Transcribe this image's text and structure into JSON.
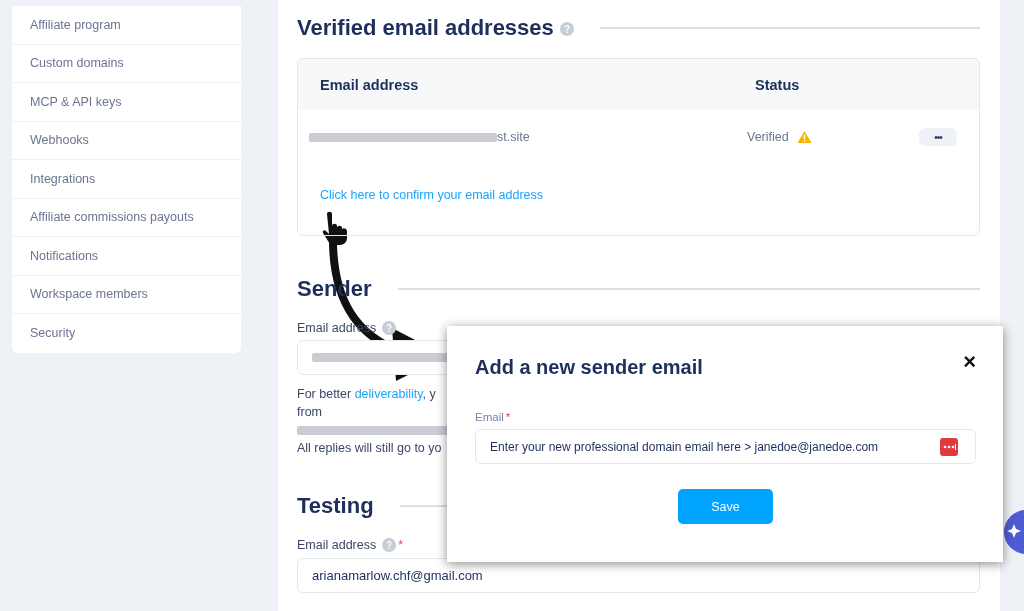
{
  "sidebar": {
    "items": [
      {
        "label": "Affiliate program"
      },
      {
        "label": "Custom domains"
      },
      {
        "label": "MCP & API keys"
      },
      {
        "label": "Webhooks"
      },
      {
        "label": "Integrations"
      },
      {
        "label": "Affiliate commissions payouts"
      },
      {
        "label": "Notifications"
      },
      {
        "label": "Workspace members"
      },
      {
        "label": "Security"
      }
    ]
  },
  "verified": {
    "title": "Verified email addresses",
    "columns": [
      "Email address",
      "Status"
    ],
    "rows": [
      {
        "email": "st.site",
        "status": "Verified",
        "warning": true,
        "menu": "•••"
      }
    ],
    "confirm_link": "Click here to confirm your email address"
  },
  "sender": {
    "title": "Sender",
    "email_label": "Email address",
    "help_lines": [
      {
        "kind": "link_line",
        "before": "For better ",
        "link": "deliverability",
        "after": ", y"
      },
      {
        "kind": "text",
        "text": "from"
      },
      {
        "kind": "redacted"
      },
      {
        "kind": "text",
        "text": "All replies will still go to yo"
      }
    ]
  },
  "testing": {
    "title": "Testing",
    "email_label": "Email address",
    "required_mark": "*",
    "value": "arianamarlow.chf@gmail.com"
  },
  "modal": {
    "title": "Add a new sender email",
    "close": "×",
    "email_label": "Email",
    "required_mark": "*",
    "placeholder": "Enter your new professional domain email here > janedoe@janedoe.com",
    "save": "Save"
  }
}
